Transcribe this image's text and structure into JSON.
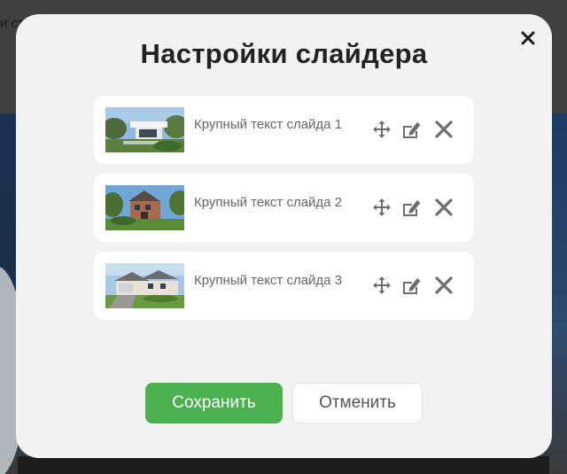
{
  "background": {
    "partial_text": "и ст"
  },
  "modal": {
    "title": "Настройки слайдера",
    "close_icon": "close-icon",
    "slides": [
      {
        "label": "Крупный текст слайда 1",
        "thumbnail": "modern-house-photo"
      },
      {
        "label": "Крупный текст слайда 2",
        "thumbnail": "brick-house-photo"
      },
      {
        "label": "Крупный текст слайда 3",
        "thumbnail": "suburban-house-photo"
      }
    ],
    "row_actions": [
      "move-icon",
      "edit-icon",
      "delete-icon"
    ],
    "save_label": "Сохранить",
    "cancel_label": "Отменить"
  },
  "colors": {
    "save_button": "#4caf50",
    "modal_bg": "#f2f2f2",
    "row_bg": "#ffffff",
    "icon_gray": "#6e6e6e"
  }
}
